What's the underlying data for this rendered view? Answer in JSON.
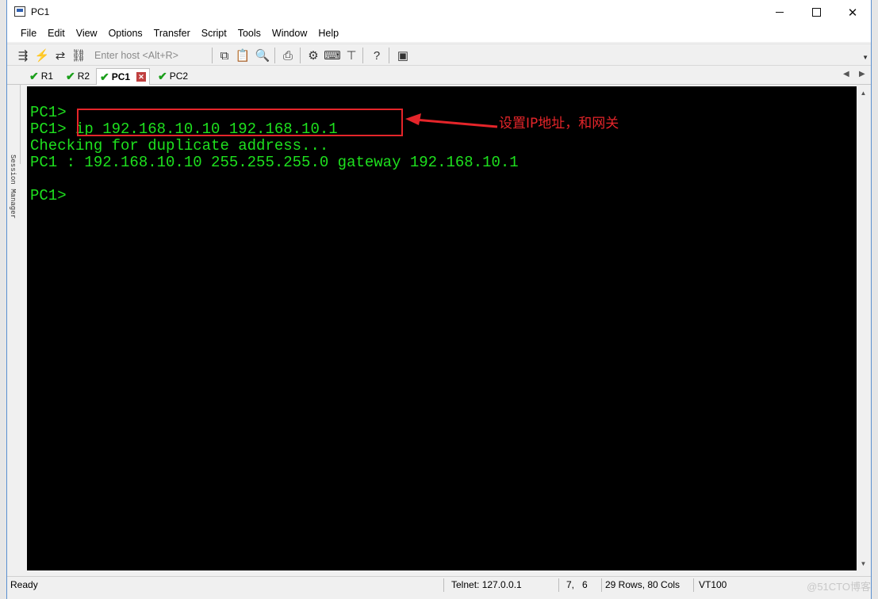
{
  "window": {
    "title": "PC1"
  },
  "menu": [
    "File",
    "Edit",
    "View",
    "Options",
    "Transfer",
    "Script",
    "Tools",
    "Window",
    "Help"
  ],
  "toolbar": {
    "host_placeholder": "Enter host <Alt+R>"
  },
  "tabs": [
    {
      "label": "R1",
      "status": "connected"
    },
    {
      "label": "R2",
      "status": "connected"
    },
    {
      "label": "PC1",
      "status": "connected",
      "active": true
    },
    {
      "label": "PC2",
      "status": "connected"
    }
  ],
  "side_panel": {
    "label": "Session Manager"
  },
  "terminal": {
    "lines": [
      "PC1>",
      "PC1> ip 192.168.10.10 192.168.10.1",
      "Checking for duplicate address...",
      "PC1 : 192.168.10.10 255.255.255.0 gateway 192.168.10.1",
      "",
      "PC1>"
    ],
    "text_color": "#1ee01e",
    "background": "#000000"
  },
  "annotation": {
    "text": "设置IP地址，和网关",
    "color": "#e5252a"
  },
  "status": {
    "ready": "Ready",
    "connection": "Telnet: 127.0.0.1",
    "cursor": "7,   6",
    "size": "29 Rows, 80 Cols",
    "emulation": "VT100",
    "watermark": "@51CTO博客"
  }
}
